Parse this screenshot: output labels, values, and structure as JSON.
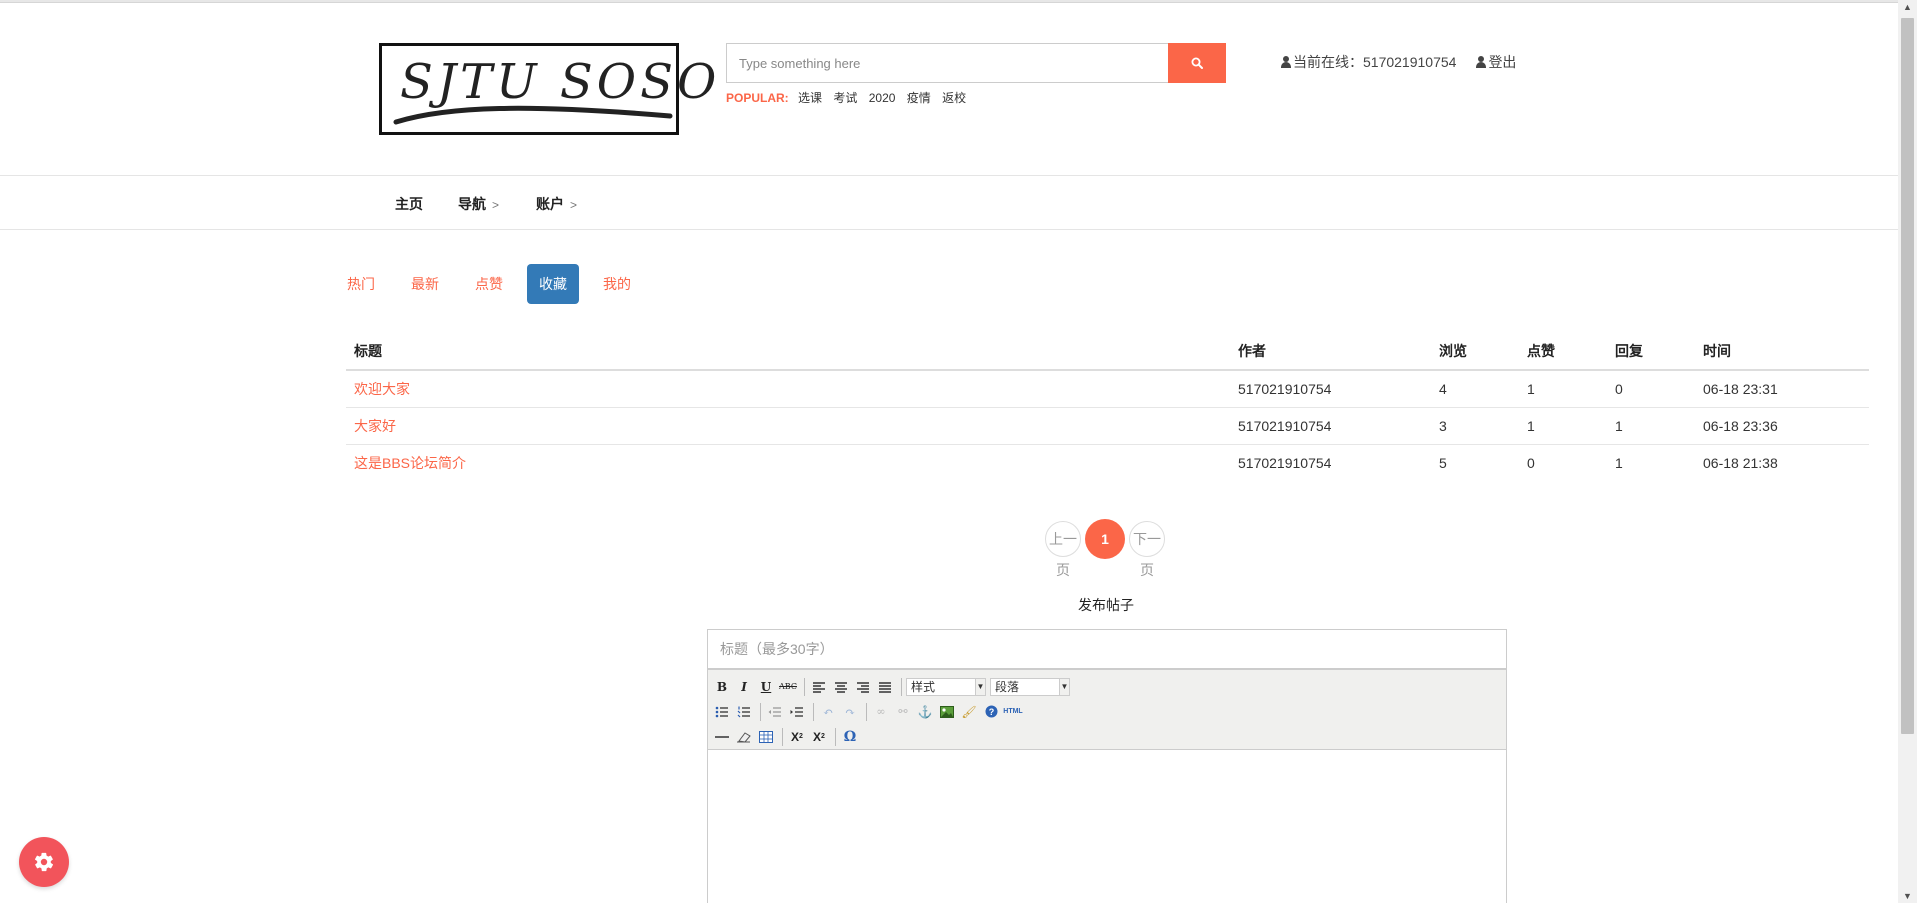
{
  "header": {
    "logo_text": "SJTU SOSO",
    "search": {
      "placeholder": "Type something here"
    },
    "popular": {
      "label": "POPULAR:",
      "tags": [
        "选课",
        "考试",
        "2020",
        "疫情",
        "返校"
      ]
    },
    "user": {
      "online_label": "当前在线：",
      "username": "517021910754",
      "logout_label": "登出"
    }
  },
  "nav": {
    "items": [
      {
        "label": "主页"
      },
      {
        "label": "导航"
      },
      {
        "label": "账户"
      }
    ]
  },
  "tabs": [
    {
      "label": "热门",
      "active": false
    },
    {
      "label": "最新",
      "active": false
    },
    {
      "label": "点赞",
      "active": false
    },
    {
      "label": "收藏",
      "active": true
    },
    {
      "label": "我的",
      "active": false
    }
  ],
  "table": {
    "headers": [
      "标题",
      "作者",
      "浏览",
      "点赞",
      "回复",
      "时间"
    ],
    "rows": [
      [
        "欢迎大家",
        "517021910754",
        "4",
        "1",
        "0",
        "06-18 23:31"
      ],
      [
        "大家好",
        "517021910754",
        "3",
        "1",
        "1",
        "06-18 23:36"
      ],
      [
        "这是BBS论坛简介",
        "517021910754",
        "5",
        "0",
        "1",
        "06-18 21:38"
      ]
    ]
  },
  "pagination": {
    "prev_line1": "上一",
    "prev_line2": "页",
    "current": "1",
    "next_line1": "下一",
    "next_line2": "页"
  },
  "post_form": {
    "heading": "发布帖子",
    "title_placeholder": "标题（最多30字）",
    "style_select": "样式",
    "format_select": "段落"
  },
  "colors": {
    "accent": "#fb6648",
    "tab_active": "#337ab7",
    "fab": "#f2545b"
  }
}
